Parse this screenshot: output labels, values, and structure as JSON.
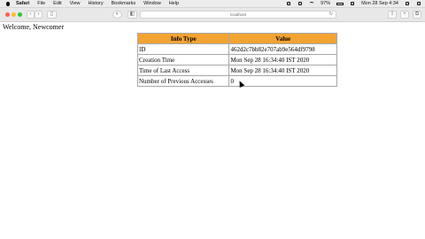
{
  "menubar": {
    "app": "Safari",
    "items": [
      "File",
      "Edit",
      "View",
      "History",
      "Bookmarks",
      "Window",
      "Help"
    ],
    "battery": "97%",
    "clock": "Mon 28 Sep 4:34"
  },
  "browser": {
    "address": "localhost"
  },
  "page": {
    "welcome": "Welcome, Newcomer",
    "table": {
      "headers": [
        "Info Type",
        "Value"
      ],
      "rows": [
        [
          "ID",
          "462d2c7bb82e707ab9e564df9798"
        ],
        [
          "Creation Time",
          "Mon Sep 28 16:34:40 IST 2020"
        ],
        [
          "Time of Last Access",
          "Mon Sep 28 16:34:40 IST 2020"
        ],
        [
          "Number of Previous Accesses",
          "0"
        ]
      ]
    }
  }
}
